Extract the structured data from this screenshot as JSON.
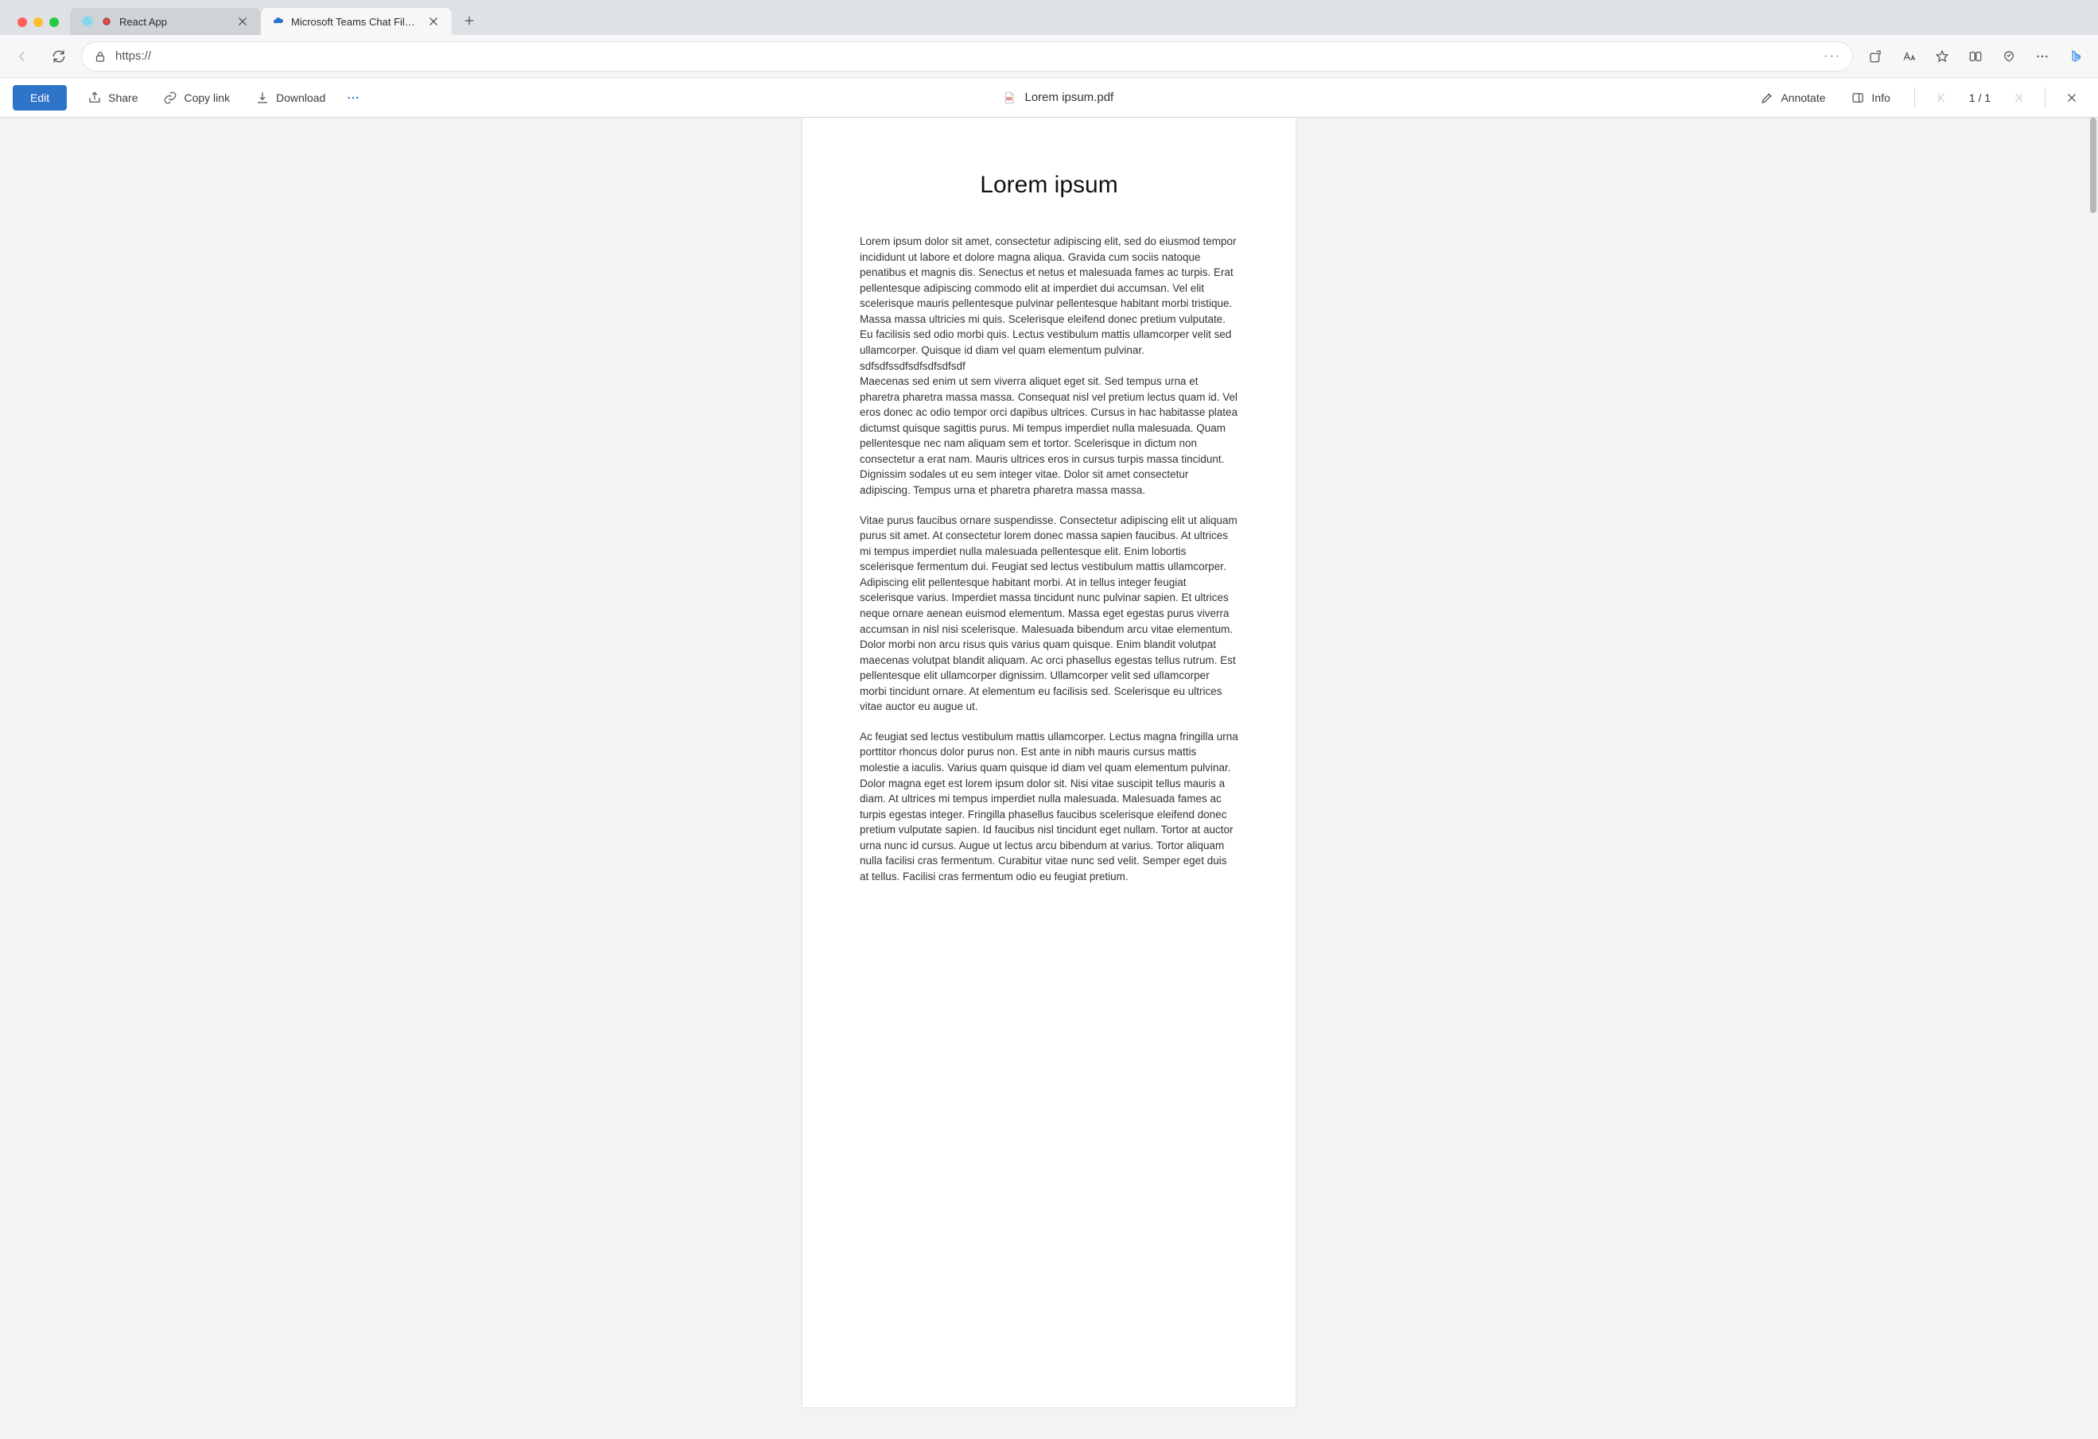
{
  "browser": {
    "tabs": [
      {
        "title": "React App",
        "favicon": "react"
      },
      {
        "title": "Microsoft Teams Chat Files - O",
        "favicon": "onedrive"
      }
    ],
    "url": "https://"
  },
  "doc_toolbar": {
    "edit": "Edit",
    "share": "Share",
    "copy_link": "Copy link",
    "download": "Download",
    "annotate": "Annotate",
    "info": "Info",
    "page_counter": "1 / 1",
    "filename": "Lorem ipsum.pdf"
  },
  "document": {
    "title": "Lorem ipsum",
    "paragraphs": [
      "Lorem ipsum dolor sit amet, consectetur adipiscing elit, sed do eiusmod tempor incididunt ut labore et dolore magna aliqua. Gravida cum sociis natoque penatibus et magnis dis. Senectus et netus et malesuada fames ac turpis. Erat pellentesque adipiscing commodo elit at imperdiet dui accumsan. Vel elit scelerisque mauris pellentesque pulvinar pellentesque habitant morbi tristique. Massa massa ultricies mi quis. Scelerisque eleifend donec pretium vulputate. Eu facilisis sed odio morbi quis. Lectus vestibulum mattis ullamcorper velit sed ullamcorper. Quisque id diam vel quam elementum pulvinar. sdfsdfssdfsdfsdfsdfsdf\nMaecenas sed enim ut sem viverra aliquet eget sit. Sed tempus urna et pharetra pharetra massa massa. Consequat nisl vel pretium lectus quam id. Vel eros donec ac odio tempor orci dapibus ultrices. Cursus in hac habitasse platea dictumst quisque sagittis purus. Mi tempus imperdiet nulla malesuada. Quam pellentesque nec nam aliquam sem et tortor. Scelerisque in dictum non consectetur a erat nam. Mauris ultrices eros in cursus turpis massa tincidunt. Dignissim sodales ut eu sem integer vitae. Dolor sit amet consectetur adipiscing. Tempus urna et pharetra pharetra massa massa.",
      "Vitae purus faucibus ornare suspendisse. Consectetur adipiscing elit ut aliquam purus sit amet. At consectetur lorem donec massa sapien faucibus. At ultrices mi tempus imperdiet nulla malesuada pellentesque elit. Enim lobortis scelerisque fermentum dui. Feugiat sed lectus vestibulum mattis ullamcorper. Adipiscing elit pellentesque habitant morbi. At in tellus integer feugiat scelerisque varius. Imperdiet massa tincidunt nunc pulvinar sapien. Et ultrices neque ornare aenean euismod elementum. Massa eget egestas purus viverra accumsan in nisl nisi scelerisque. Malesuada bibendum arcu vitae elementum. Dolor morbi non arcu risus quis varius quam quisque. Enim blandit volutpat maecenas volutpat blandit aliquam. Ac orci phasellus egestas tellus rutrum. Est pellentesque elit ullamcorper dignissim. Ullamcorper velit sed ullamcorper morbi tincidunt ornare. At elementum eu facilisis sed. Scelerisque eu ultrices vitae auctor eu augue ut.",
      "Ac feugiat sed lectus vestibulum mattis ullamcorper. Lectus magna fringilla urna porttitor rhoncus dolor purus non. Est ante in nibh mauris cursus mattis molestie a iaculis. Varius quam quisque id diam vel quam elementum pulvinar. Dolor magna eget est lorem ipsum dolor sit. Nisi vitae suscipit tellus mauris a diam. At ultrices mi tempus imperdiet nulla malesuada. Malesuada fames ac turpis egestas integer. Fringilla phasellus faucibus scelerisque eleifend donec pretium vulputate sapien. Id faucibus nisl tincidunt eget nullam. Tortor at auctor urna nunc id cursus. Augue ut lectus arcu bibendum at varius. Tortor aliquam nulla facilisi cras fermentum. Curabitur vitae nunc sed velit. Semper eget duis at tellus. Facilisi cras fermentum odio eu feugiat pretium."
    ]
  }
}
